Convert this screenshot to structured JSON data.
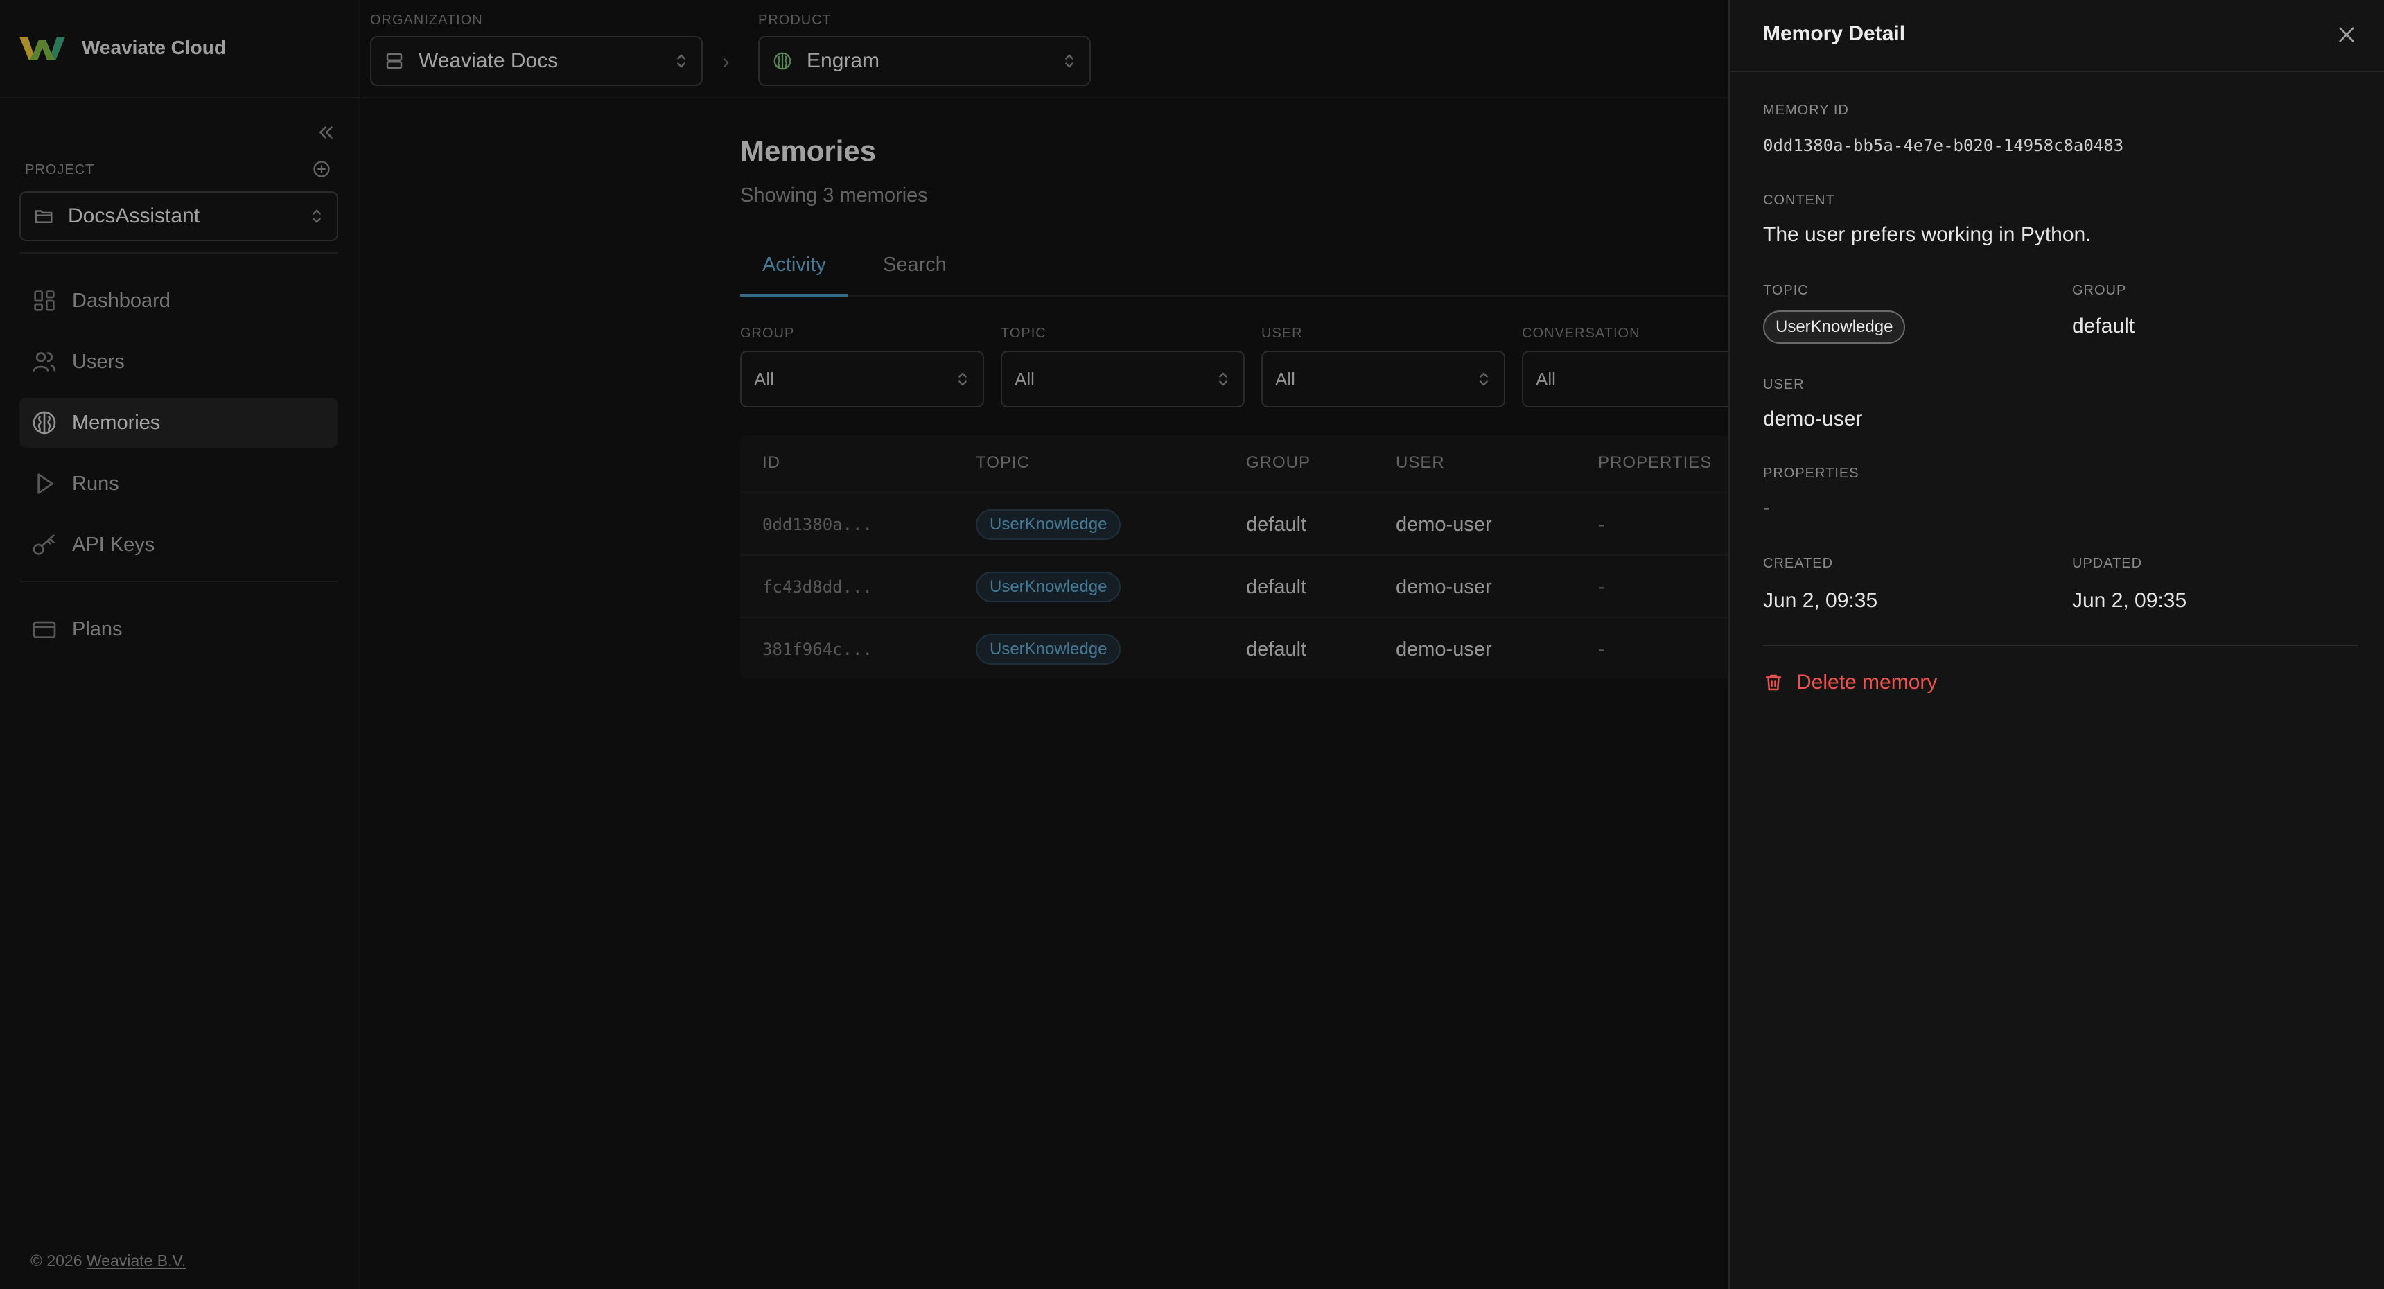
{
  "brand": {
    "name": "Weaviate Cloud"
  },
  "sidebar": {
    "project_label": "PROJECT",
    "project_value": "DocsAssistant",
    "items": [
      {
        "label": "Dashboard",
        "icon": "dashboard-icon"
      },
      {
        "label": "Users",
        "icon": "users-icon"
      },
      {
        "label": "Memories",
        "icon": "brain-icon",
        "active": true
      },
      {
        "label": "Runs",
        "icon": "play-icon"
      },
      {
        "label": "API Keys",
        "icon": "key-icon"
      },
      {
        "label": "Plans",
        "icon": "credit-card-icon"
      }
    ],
    "footer_prefix": "© 2026",
    "footer_link": "Weaviate B.V."
  },
  "topbar": {
    "org_label": "ORGANIZATION",
    "org_value": "Weaviate Docs",
    "separator": "›",
    "product_label": "PRODUCT",
    "product_value": "Engram"
  },
  "main": {
    "title": "Memories",
    "subtitle": "Showing 3 memories",
    "tabs": [
      {
        "label": "Activity",
        "active": true
      },
      {
        "label": "Search",
        "active": false
      }
    ],
    "filters": [
      {
        "label": "GROUP",
        "value": "All"
      },
      {
        "label": "TOPIC",
        "value": "All"
      },
      {
        "label": "USER",
        "value": "All"
      },
      {
        "label": "CONVERSATION",
        "value": "All"
      }
    ],
    "table": {
      "columns": [
        "ID",
        "TOPIC",
        "GROUP",
        "USER",
        "PROPERTIES"
      ],
      "rows": [
        {
          "id": "0dd1380a...",
          "topic": "UserKnowledge",
          "group": "default",
          "user": "demo-user",
          "properties": "-"
        },
        {
          "id": "fc43d8dd...",
          "topic": "UserKnowledge",
          "group": "default",
          "user": "demo-user",
          "properties": "-"
        },
        {
          "id": "381f964c...",
          "topic": "UserKnowledge",
          "group": "default",
          "user": "demo-user",
          "properties": "-"
        }
      ]
    }
  },
  "drawer": {
    "title": "Memory Detail",
    "memory_id_label": "MEMORY ID",
    "memory_id": "0dd1380a-bb5a-4e7e-b020-14958c8a0483",
    "content_label": "CONTENT",
    "content": "The user prefers working in Python.",
    "topic_label": "TOPIC",
    "topic": "UserKnowledge",
    "group_label": "GROUP",
    "group": "default",
    "user_label": "USER",
    "user": "demo-user",
    "properties_label": "PROPERTIES",
    "properties": "-",
    "created_label": "CREATED",
    "created": "Jun 2, 09:35",
    "updated_label": "UPDATED",
    "updated": "Jun 2, 09:35",
    "delete_label": "Delete memory"
  },
  "colors": {
    "accent": "#5fa8cf",
    "danger": "#ef5350",
    "background": "#121212",
    "panel": "#141414"
  }
}
